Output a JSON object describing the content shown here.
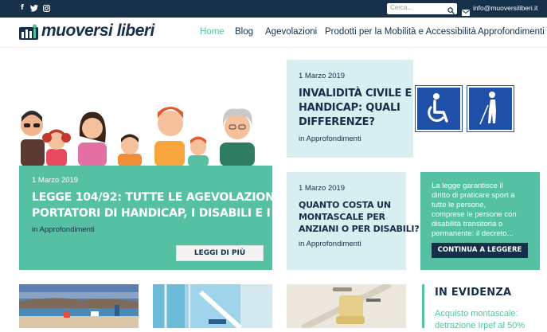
{
  "topbar": {
    "social": [
      "f",
      "t",
      "ig"
    ],
    "search_placeholder": "Cerca...",
    "email": "info@muoversiliberi.it"
  },
  "header": {
    "logo": "muoversi liberi",
    "nav": [
      "Home",
      "Blog",
      "Agevolazioni",
      "Prodotti per la Mobilità e Accessibilità",
      "Approfondimenti"
    ],
    "active_nav": "Home"
  },
  "hero": {
    "date": "1 Marzo 2019",
    "title_line1": "LEGGE 104/92: TUTTE LE AGEVOLAZIONI PER I",
    "title_line2": "PORTATORI DI HANDICAP, I DISABILI E I LORO...",
    "category": "in Approfondimenti",
    "button": "LEGGI DI PIÙ"
  },
  "card1": {
    "date": "1 Marzo 2019",
    "title_line1": "INVALIDITÀ CIVILE E",
    "title_line2": "HANDICAP: QUALI",
    "title_line3": "DIFFERENZE?",
    "category": "in Approfondimenti"
  },
  "card2": {
    "date": "1 Marzo 2019",
    "title_line1": "QUANTO COSTA UN",
    "title_line2": "MONTASCALE PER",
    "title_line3": "ANZIANI O PER DISABILI?",
    "category": "in Approfondimenti"
  },
  "card3": {
    "text_line1": "La legge garantisce il",
    "text_line2": "diritto di praticare sport a",
    "text_line3": "tutte le persone,",
    "text_line4": "comprese le persone con",
    "text_line5": "disabilità transitoria o",
    "text_line6": "permanente: il decreto...",
    "button": "CONTINUA A LEGGERE"
  },
  "evidenza": {
    "title": "IN EVIDENZA",
    "item_line1": "Acquisto montascale:",
    "item_line2": "detrazione Irpef al 50%"
  },
  "colors": {
    "navy": "#16304a",
    "green": "#56c1a2",
    "light_blue": "#d8eef1",
    "sign_blue": "#1f4fa6"
  }
}
